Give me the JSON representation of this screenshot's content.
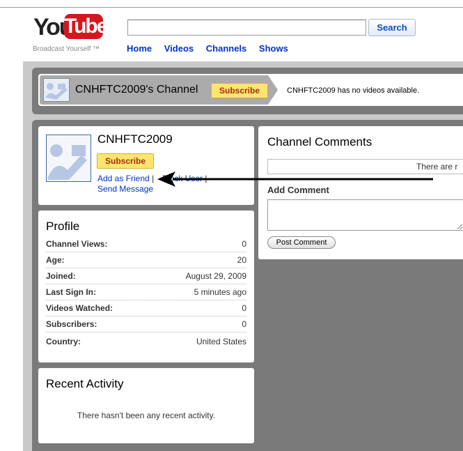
{
  "header": {
    "logo_you": "You",
    "logo_tube": "Tube",
    "tagline": "Broadcast Yourself ™",
    "search_placeholder": "",
    "search_button": "Search",
    "nav": [
      "Home",
      "Videos",
      "Channels",
      "Shows"
    ]
  },
  "channel_header": {
    "title": "CNHFTC2009's Channel",
    "subscribe_label": "Subscribe",
    "message": "CNHFTC2009 has no videos available."
  },
  "user_box": {
    "name": "CNHFTC2009",
    "subscribe_label": "Subscribe",
    "add_friend": "Add as Friend",
    "separator": "|",
    "block_user": "Block User",
    "separator2": "|",
    "send_message": "Send Message"
  },
  "profile": {
    "title": "Profile",
    "rows": [
      {
        "label": "Channel Views:",
        "value": "0"
      },
      {
        "label": "Age:",
        "value": "20"
      },
      {
        "label": "Joined:",
        "value": "August 29, 2009"
      },
      {
        "label": "Last Sign In:",
        "value": "5 minutes ago"
      },
      {
        "label": "Videos Watched:",
        "value": "0"
      },
      {
        "label": "Subscribers:",
        "value": "0"
      },
      {
        "label": "Country:",
        "value": "United States"
      }
    ]
  },
  "activity": {
    "title": "Recent Activity",
    "message": "There hasn't been any recent activity."
  },
  "comments": {
    "title": "Channel Comments",
    "empty_text": "There are r",
    "add_title": "Add Comment",
    "post_button": "Post Comment"
  },
  "colors": {
    "link": "#0033cc",
    "subscribe_bg": "#fde66f",
    "brand_red": "#d5161f"
  }
}
